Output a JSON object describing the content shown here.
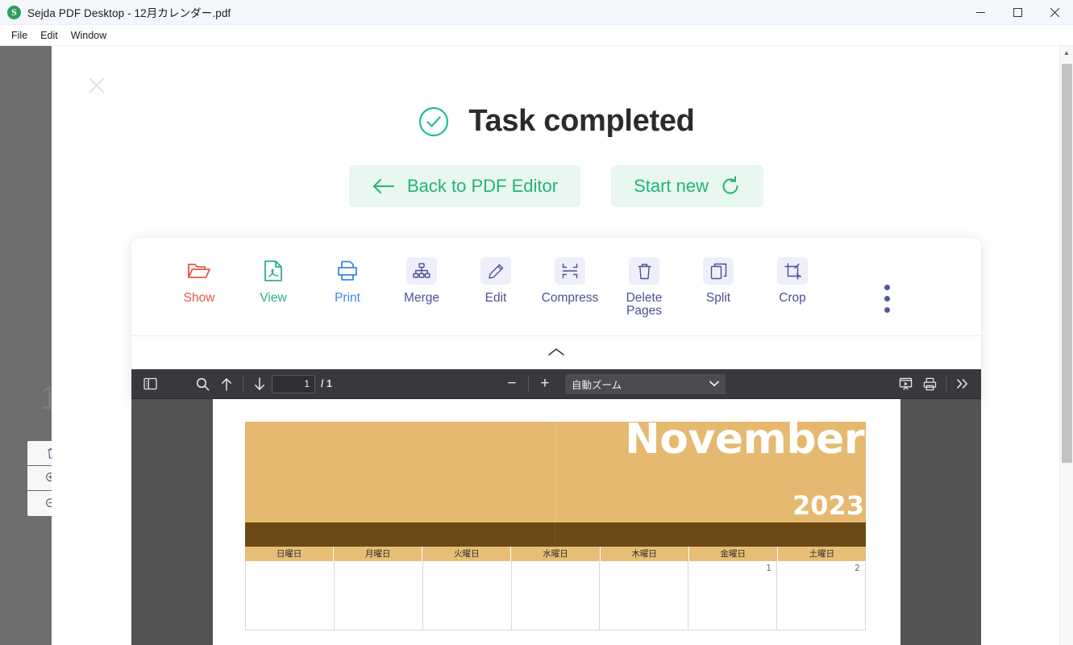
{
  "window": {
    "title": "Sejda PDF Desktop - 12月カレンダー.pdf",
    "logo_letter": "S",
    "minimize_label": "─",
    "maximize_label": "☐",
    "close_label": "✕"
  },
  "menubar": {
    "items": [
      {
        "label": "File"
      },
      {
        "label": "Edit"
      },
      {
        "label": "Window"
      }
    ]
  },
  "overlay": {
    "close_label": "✕",
    "status_title": "Task completed",
    "buttons": [
      {
        "label": "Back to PDF Editor",
        "icon": "arrow-left-icon"
      },
      {
        "label": "Start new",
        "icon": "refresh-icon"
      }
    ]
  },
  "toolcard": {
    "tools": [
      {
        "label": "Show",
        "icon": "open-folder-icon",
        "color": "#e8564a",
        "badge": false
      },
      {
        "label": "View",
        "icon": "pdf-file-icon",
        "color": "#27b67a",
        "badge": false
      },
      {
        "label": "Print",
        "icon": "printer-icon",
        "color": "#3b86e8",
        "badge": false
      },
      {
        "label": "Merge",
        "icon": "merge-icon",
        "color": "#4c5096",
        "badge": true
      },
      {
        "label": "Edit",
        "icon": "pencil-icon",
        "color": "#4c5096",
        "badge": true
      },
      {
        "label": "Compress",
        "icon": "compress-icon",
        "color": "#4c5096",
        "badge": true
      },
      {
        "label": "Delete Pages",
        "icon": "trash-icon",
        "color": "#4c5096",
        "badge": true
      },
      {
        "label": "Split",
        "icon": "split-icon",
        "color": "#4c5096",
        "badge": true
      },
      {
        "label": "Crop",
        "icon": "crop-icon",
        "color": "#4c5096",
        "badge": true
      }
    ],
    "overflow_icon": "kebab-menu-icon",
    "collapse_icon": "chevron-up-icon"
  },
  "pdf_toolbar": {
    "sidebar_icon": "sidebar-toggle-icon",
    "search_icon": "search-icon",
    "prev_icon": "arrow-up-icon",
    "next_icon": "arrow-down-icon",
    "page_number": "1",
    "page_total": "/ 1",
    "zoom_out_label": "−",
    "zoom_in_label": "+",
    "zoom_value": "自動ズーム",
    "zoom_caret": "⌄",
    "presentation_icon": "presentation-mode-icon",
    "print_icon": "printer-icon",
    "more_icon": "double-chevron-right-icon"
  },
  "calendar": {
    "month": "November",
    "year": "2023",
    "weekdays": [
      "日曜日",
      "月曜日",
      "火曜日",
      "水曜日",
      "木曜日",
      "金曜日",
      "土曜日"
    ],
    "first_week": [
      "",
      "",
      "",
      "",
      "",
      "1",
      "2"
    ],
    "colors": {
      "hero": "#e5b96f",
      "brown_bar": "#6b4a15",
      "weekday_header": "#e8bd76"
    }
  },
  "background": {
    "ghost_number": "1",
    "tools": [
      {
        "icon": "trash-icon"
      },
      {
        "icon": "zoom-in-icon"
      },
      {
        "icon": "zoom-out-icon"
      }
    ]
  },
  "scrollbar": {
    "up_label": "▲",
    "down_label": "▼"
  }
}
